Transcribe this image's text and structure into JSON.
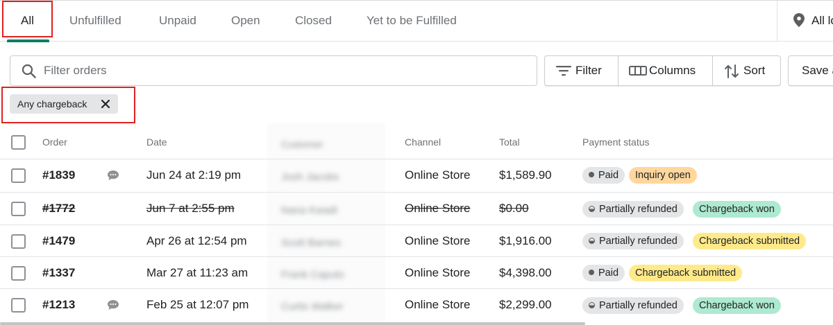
{
  "tabs": [
    {
      "label": "All",
      "active": true
    },
    {
      "label": "Unfulfilled"
    },
    {
      "label": "Unpaid"
    },
    {
      "label": "Open"
    },
    {
      "label": "Closed"
    },
    {
      "label": "Yet to be Fulfilled"
    }
  ],
  "location": {
    "label": "All lo",
    "icon": "location-pin-icon"
  },
  "search": {
    "placeholder": "Filter orders",
    "icon": "search-icon"
  },
  "toolbar": {
    "filter_label": "Filter",
    "columns_label": "Columns",
    "sort_label": "Sort",
    "save_label": "Save a"
  },
  "active_filter": {
    "label": "Any chargeback",
    "remove_icon": "close-icon"
  },
  "table": {
    "headers": {
      "order": "Order",
      "date": "Date",
      "customer": "Customer",
      "channel": "Channel",
      "total": "Total",
      "payment_status": "Payment status"
    },
    "rows": [
      {
        "order": "#1839",
        "has_comment": true,
        "date": "Jun 24 at 2:19 pm",
        "customer": "Josh Jacobs",
        "channel": "Online Store",
        "total": "$1,589.90",
        "payment": "Paid",
        "chargeback": "Inquiry open",
        "struck": false
      },
      {
        "order": "#1772",
        "has_comment": false,
        "date": "Jun 7 at 2:55 pm",
        "customer": "Nana Kwadi",
        "channel": "Online Store",
        "total": "$0.00",
        "payment": "Partially refunded",
        "chargeback": "Chargeback won",
        "struck": true
      },
      {
        "order": "#1479",
        "has_comment": false,
        "date": "Apr 26 at 12:54 pm",
        "customer": "Scott Barnes",
        "channel": "Online Store",
        "total": "$1,916.00",
        "payment": "Partially refunded",
        "chargeback": "Chargeback submitted",
        "struck": false
      },
      {
        "order": "#1337",
        "has_comment": false,
        "date": "Mar 27 at 11:23 am",
        "customer": "Frank Caputo",
        "channel": "Online Store",
        "total": "$4,398.00",
        "payment": "Paid",
        "chargeback": "Chargeback submitted",
        "struck": false
      },
      {
        "order": "#1213",
        "has_comment": true,
        "date": "Feb 25 at 12:07 pm",
        "customer": "Curtis Walker",
        "channel": "Online Store",
        "total": "$2,299.00",
        "payment": "Partially refunded",
        "chargeback": "Chargeback won",
        "struck": false
      }
    ]
  },
  "colors": {
    "accent_green": "#008060",
    "highlight_red": "#e02020",
    "badge_orange": "#ffd79d",
    "badge_yellow": "#ffea8a",
    "badge_green": "#aee9d1",
    "badge_gray": "#e4e5e7"
  }
}
